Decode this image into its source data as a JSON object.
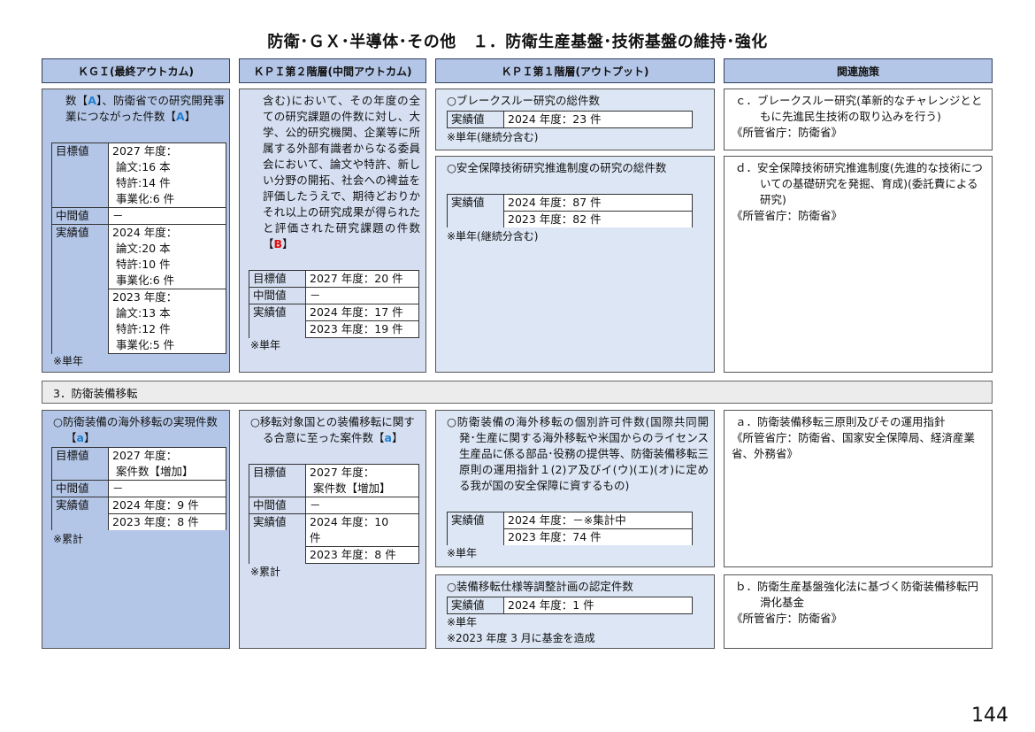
{
  "title": "防衛･ＧＸ･半導体･その他　１．防衛生産基盤･技術基盤の維持･強化",
  "headers": {
    "kgi": "ＫＧＩ(最終アウトカム)",
    "kpi2": "ＫＰＩ第２階層(中間アウトカム)",
    "kpi1": "ＫＰＩ第１階層(アウトプット)",
    "related": "関連施策"
  },
  "block1": {
    "kgi": {
      "text_pre": "数【",
      "text_mark": "A",
      "text_mid": "】、防衛省での研究開発事業につながった件数【",
      "text_mark2": "A",
      "text_post": "】",
      "rows": {
        "target_label": "目標値",
        "target_value_1": "2027 年度：",
        "target_value_2": "論文:16 本",
        "target_value_3": "特許:14 件",
        "target_value_4": "事業化:6 件",
        "mid_label": "中間値",
        "mid_value": "－",
        "actual_label": "実績値",
        "actual_a_1": "2024 年度：",
        "actual_a_2": "論文:20 本",
        "actual_a_3": "特許:10 件",
        "actual_a_4": "事業化:6 件",
        "actual_b_1": "2023 年度：",
        "actual_b_2": "論文:13 本",
        "actual_b_3": "特許:12 件",
        "actual_b_4": "事業化:5 件"
      },
      "note": "※単年"
    },
    "kpi2": {
      "text": "含む)において、その年度の全ての研究課題の件数に対し、大学、公的研究機関、企業等に所属する外部有識者からなる委員会において、論文や特許、新しい分野の開拓、社会への裨益を評価したうえで、期待どおりかそれ以上の研究成果が得られたと評価された研究課題の件数【",
      "text_mark": "B",
      "text_post": "】",
      "target_label": "目標値",
      "target_value": "2027 年度：20 件",
      "mid_label": "中間値",
      "mid_value": "－",
      "actual_label": "実績値",
      "actual_a": "2024 年度：17 件",
      "actual_b": "2023 年度：19 件",
      "note": "※単年"
    },
    "kpi1_a": {
      "title": "○ブレークスルー研究の総件数",
      "actual_label": "実績値",
      "actual_value": "2024 年度：23 件",
      "note": "※単年(継続分含む)"
    },
    "kpi1_b": {
      "title": "○安全保障技術研究推進制度の研究の総件数",
      "actual_label": "実績値",
      "actual_a": "2024 年度：87 件",
      "actual_b": "2023 年度：82 件",
      "note": "※単年(継続分含む)"
    },
    "rel_c": {
      "line1": "ｃ．ブレークスルー研究(革新的なチャレンジとともに先進民生技術の取り込みを行う)",
      "line2": "《所管省庁：防衛省》"
    },
    "rel_d": {
      "line1": "ｄ．安全保障技術研究推進制度(先進的な技術についての基礎研究を発掘、育成)(委託費による研究)",
      "line2": "《所管省庁：防衛省》"
    }
  },
  "section3": "3．防衛装備移転",
  "block2": {
    "kgi": {
      "text_pre": "○防衛装備の海外移転の実現件数【",
      "text_mark": "a",
      "text_post": "】",
      "target_label": "目標値",
      "target_value_1": "2027 年度：",
      "target_value_2": "案件数【増加】",
      "mid_label": "中間値",
      "mid_value": "－",
      "actual_label": "実績値",
      "actual_a": "2024 年度：9 件",
      "actual_b": "2023 年度：8 件",
      "note": "※累計"
    },
    "kpi2": {
      "text_pre": "○移転対象国との装備移転に関する合意に至った案件数【",
      "text_mark": "a",
      "text_post": "】",
      "target_label": "目標値",
      "target_value_1": "2027 年度：",
      "target_value_2": "案件数【増加】",
      "mid_label": "中間値",
      "mid_value": "－",
      "actual_label": "実績値",
      "actual_a_1": "2024 年度：10",
      "actual_a_2": "件",
      "actual_b": "2023 年度：8 件",
      "note": "※累計"
    },
    "kpi1_a": {
      "title": "○防衛装備の海外移転の個別許可件数(国際共同開発･生産に関する海外移転や米国からのライセンス生産品に係る部品･役務の提供等、防衛装備移転三原則の運用指針１(2)ア及びイ(ウ)(エ)(オ)に定める我が国の安全保障に資するもの)",
      "actual_label": "実績値",
      "actual_a": "2024 年度：－※集計中",
      "actual_b": "2023 年度：74 件",
      "note": "※単年"
    },
    "kpi1_b": {
      "title": "○装備移転仕様等調整計画の認定件数",
      "actual_label": "実績値",
      "actual_value": "2024 年度：1 件",
      "note1": "※単年",
      "note2": "※2023 年度 3 月に基金を造成"
    },
    "rel_a": {
      "line1": "ａ．防衛装備移転三原則及びその運用指針",
      "line2": "《所管省庁：防衛省、国家安全保障局、経済産業省、外務省》"
    },
    "rel_b": {
      "line1": "ｂ．防衛生産基盤強化法に基づく防衛装備移転円滑化基金",
      "line2": "《所管省庁：防衛省》"
    }
  },
  "page_number": "144"
}
